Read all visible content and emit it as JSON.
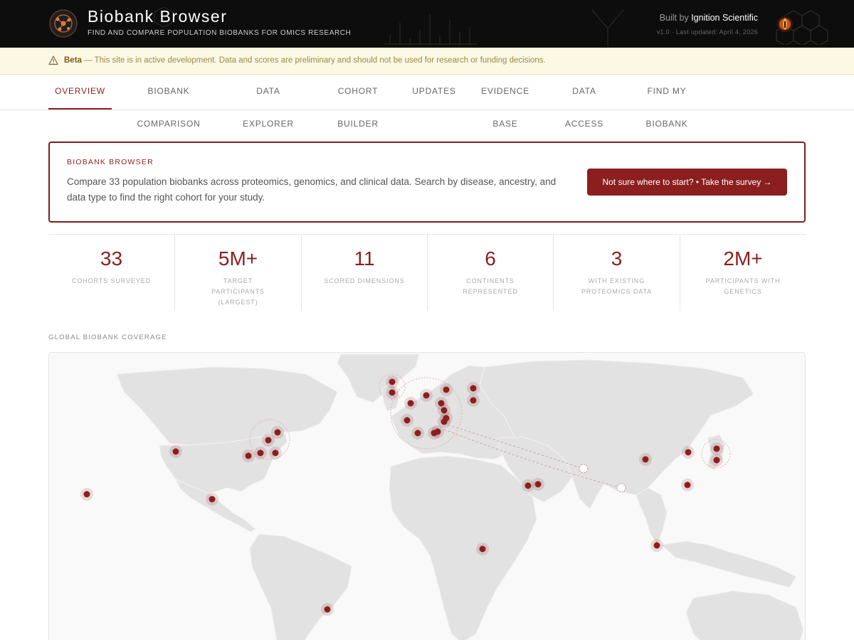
{
  "header": {
    "title": "Biobank Browser",
    "subtitle": "FIND AND COMPARE POPULATION BIOBANKS FOR OMICS RESEARCH",
    "built_by_prefix": "Built by",
    "built_by_name": "Ignition Scientific",
    "version": "v1.0 · Last updated: April 4, 2026"
  },
  "beta": {
    "label": "Beta",
    "message": " — This site is in active development. Data and scores are preliminary and should not be used for research or funding decisions."
  },
  "nav": {
    "tabs": [
      "OVERVIEW",
      "BIOBANK COMPARISON",
      "DATA EXPLORER",
      "COHORT BUILDER",
      "UPDATES",
      "EVIDENCE BASE",
      "DATA ACCESS",
      "FIND MY BIOBANK"
    ],
    "active_index": 0
  },
  "intro": {
    "eyebrow": "BIOBANK BROWSER",
    "description": "Compare 33 population biobanks across proteomics, genomics, and clinical data. Search by disease, ancestry, and data type to find the right cohort for your study.",
    "cta_label": "Not sure where to start? • Take the survey →"
  },
  "stats": [
    {
      "value": "33",
      "label": "COHORTS SURVEYED"
    },
    {
      "value": "5M+",
      "label": "TARGET PARTICIPANTS (LARGEST)"
    },
    {
      "value": "11",
      "label": "SCORED DIMENSIONS"
    },
    {
      "value": "6",
      "label": "CONTINENTS REPRESENTED"
    },
    {
      "value": "3",
      "label": "WITH EXISTING PROTEOMICS DATA"
    },
    {
      "value": "2M+",
      "label": "PARTICIPANTS WITH GENETICS"
    }
  ],
  "map": {
    "section_label": "GLOBAL BIOBANK COVERAGE"
  },
  "colors": {
    "accent": "#8b1f1f",
    "header_bg": "#0d0d0d",
    "beta_bg": "#fdf8e4",
    "land": "#e2e2e2"
  }
}
